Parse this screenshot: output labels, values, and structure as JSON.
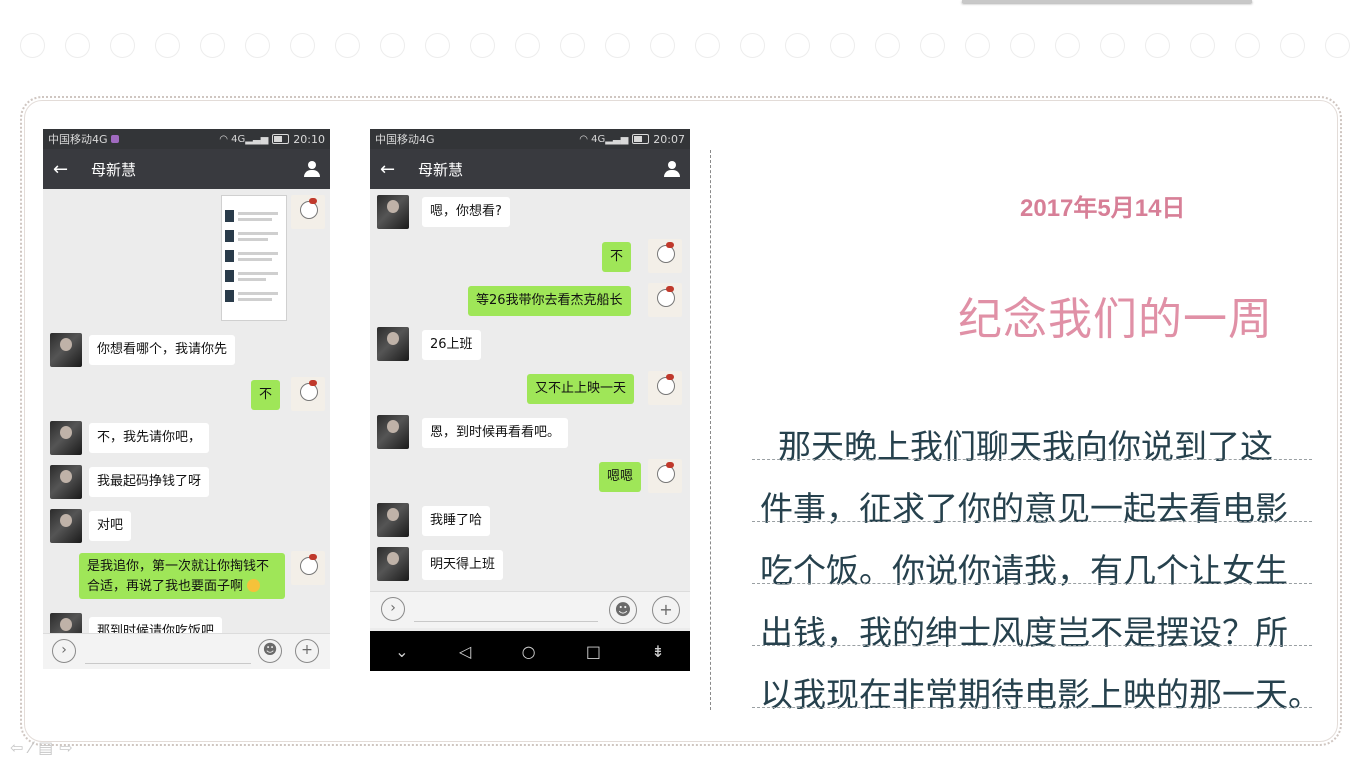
{
  "slide": {
    "date": "2017年5月14日",
    "heading": "纪念我们的一周",
    "paragraph_lines": [
      "那天晚上我们聊天我向你说到了这",
      "件事，征求了你的意见一起去看电影",
      "吃个饭。你说你请我，有几个让女生",
      "出钱，我的绅士风度岂不是摆设？所",
      "以我现在非常期待电影上映的那一天。"
    ]
  },
  "phone1": {
    "carrier": "中国移动4G",
    "network": "4G",
    "time": "20:10",
    "contact": "母新慧",
    "messages": {
      "m1": "你想看哪个，我请你先",
      "m2": "不",
      "m3": "不，我先请你吧，",
      "m4": "我最起码挣钱了呀",
      "m5": "对吧",
      "m6": "是我追你，第一次就让你掏钱不合适，再说了我也要面子啊",
      "m7": "那到时候请你吃饭吧"
    }
  },
  "phone2": {
    "carrier": "中国移动4G",
    "network": "4G",
    "time": "20:07",
    "contact": "母新慧",
    "messages": {
      "m1": "嗯，你想看?",
      "m2": "不",
      "m3": "等26我带你去看杰克船长",
      "m4": "26上班",
      "m5": "又不止上映一天",
      "m6": "恩，到时候再看看吧。",
      "m7": "嗯嗯",
      "m8": "我睡了哈",
      "m9": "明天得上班"
    }
  },
  "icons": {
    "back": "arrow-left-icon",
    "contact": "person-icon",
    "voice": "voice-icon",
    "emoji": "emoji-icon",
    "plus": "plus-icon"
  },
  "colors": {
    "accent_pink": "#d77f97",
    "wechat_green": "#9fe658",
    "text_dark": "#26414d"
  }
}
